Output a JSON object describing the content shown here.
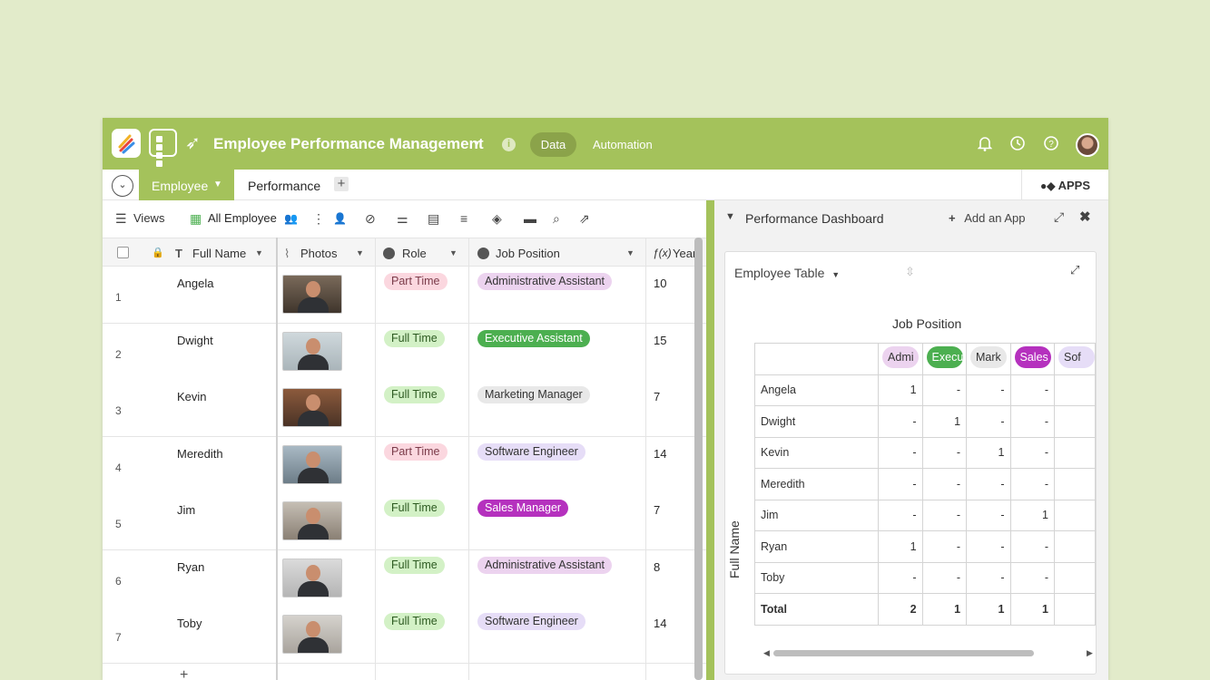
{
  "topbar": {
    "title": "Employee Performance Management",
    "info": "i",
    "data_tab": "Data",
    "automation_tab": "Automation"
  },
  "tabs": {
    "employee": "Employee",
    "performance": "Performance",
    "add": "+",
    "apps": "APPS"
  },
  "toolbar": {
    "views": "Views",
    "view_name": "All Employee"
  },
  "table": {
    "columns": [
      "Full Name",
      "Photos",
      "Role",
      "Job Position",
      "Years"
    ],
    "rows": [
      {
        "n": "1",
        "name": "Angela",
        "role": "Part Time",
        "job": "Administrative Assistant",
        "years": "10"
      },
      {
        "n": "2",
        "name": "Dwight",
        "role": "Full Time",
        "job": "Executive Assistant",
        "years": "15"
      },
      {
        "n": "3",
        "name": "Kevin",
        "role": "Full Time",
        "job": "Marketing Manager",
        "years": "7"
      },
      {
        "n": "4",
        "name": "Meredith",
        "role": "Part Time",
        "job": "Software Engineer",
        "years": "14"
      },
      {
        "n": "5",
        "name": "Jim",
        "role": "Full Time",
        "job": "Sales Manager",
        "years": "7"
      },
      {
        "n": "6",
        "name": "Ryan",
        "role": "Full Time",
        "job": "Administrative Assistant",
        "years": "8"
      },
      {
        "n": "7",
        "name": "Toby",
        "role": "Full Time",
        "job": "Software Engineer",
        "years": "14"
      }
    ],
    "add_row": "+"
  },
  "colors": {
    "brand": "#a4c25b",
    "part_time_bg": "#fbd7df",
    "full_time_bg": "#d3f1c6",
    "admin_bg": "#ecd3ef",
    "exec_bg": "#4caf50",
    "marketing_bg": "#e8e8e8",
    "software_bg": "#e6ddf7",
    "sales_bg": "#b531be"
  },
  "panel": {
    "title": "Performance Dashboard",
    "add_app": "Add an App",
    "card_title": "Employee Table",
    "column_title": "Job Position",
    "row_title": "Full Name",
    "columns": [
      "Admi",
      "Execu",
      "Mark",
      "Sales",
      "Sof"
    ],
    "rows": [
      {
        "name": "Angela",
        "v": [
          "1",
          "-",
          "-",
          "-",
          ""
        ]
      },
      {
        "name": "Dwight",
        "v": [
          "-",
          "1",
          "-",
          "-",
          ""
        ]
      },
      {
        "name": "Kevin",
        "v": [
          "-",
          "-",
          "1",
          "-",
          ""
        ]
      },
      {
        "name": "Meredith",
        "v": [
          "-",
          "-",
          "-",
          "-",
          ""
        ]
      },
      {
        "name": "Jim",
        "v": [
          "-",
          "-",
          "-",
          "1",
          ""
        ]
      },
      {
        "name": "Ryan",
        "v": [
          "1",
          "-",
          "-",
          "-",
          ""
        ]
      },
      {
        "name": "Toby",
        "v": [
          "-",
          "-",
          "-",
          "-",
          ""
        ]
      }
    ],
    "total": {
      "name": "Total",
      "v": [
        "2",
        "1",
        "1",
        "1",
        ""
      ]
    }
  }
}
